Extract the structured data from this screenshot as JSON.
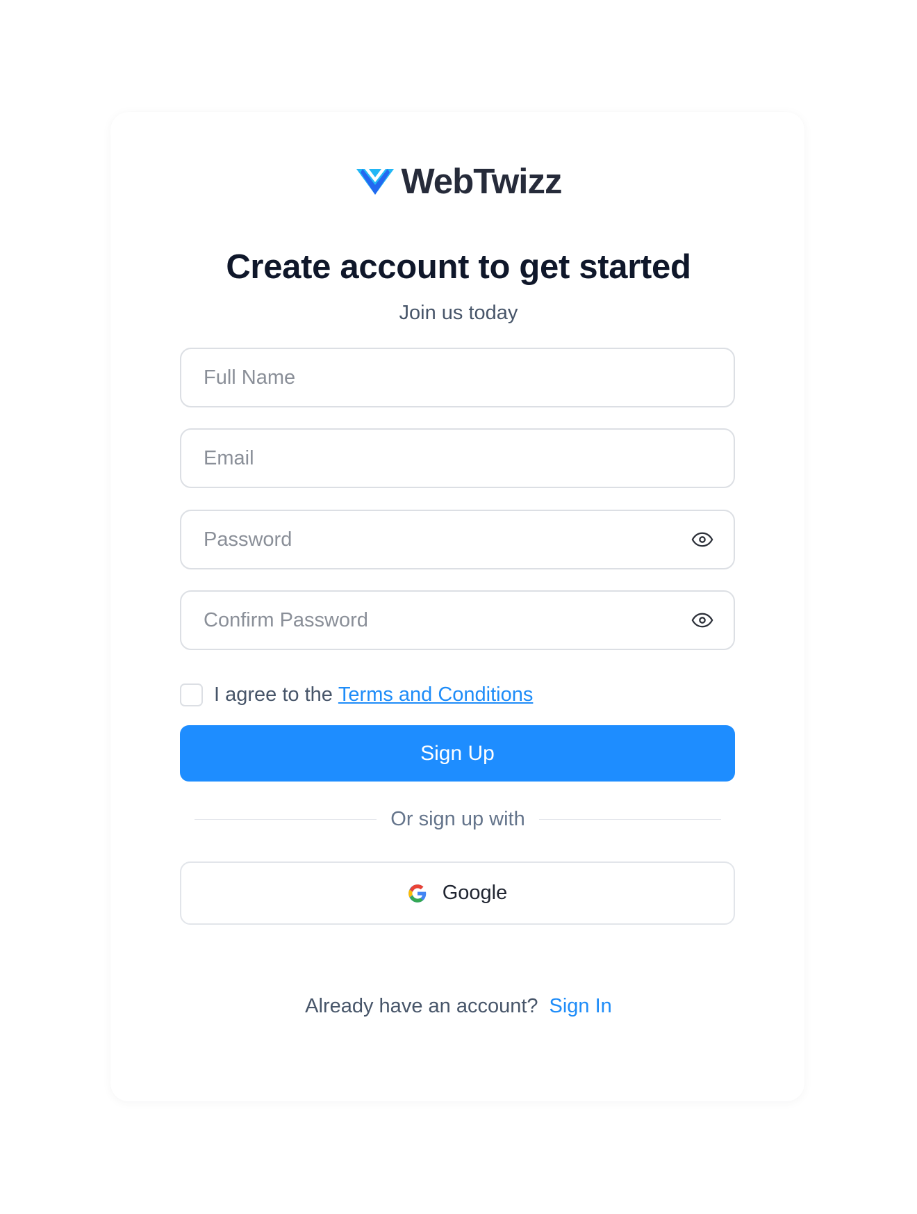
{
  "brand": {
    "name": "WebTwizz",
    "logo_icon": "webtwizz-logo-icon",
    "colors": {
      "primary": "#1e8dff",
      "logo_light": "#22b7f5",
      "logo_dark": "#2368f0"
    }
  },
  "header": {
    "title": "Create account to get started",
    "subtitle": "Join us today"
  },
  "form": {
    "full_name": {
      "placeholder": "Full Name",
      "value": ""
    },
    "email": {
      "placeholder": "Email",
      "value": ""
    },
    "password": {
      "placeholder": "Password",
      "value": "",
      "toggle_icon": "eye-icon"
    },
    "confirm_password": {
      "placeholder": "Confirm Password",
      "value": "",
      "toggle_icon": "eye-icon"
    },
    "agree": {
      "checked": false,
      "text": "I agree to the",
      "link_text": "Terms and Conditions"
    },
    "submit_label": "Sign Up"
  },
  "social": {
    "divider_text": "Or sign up with",
    "google": {
      "label": "Google",
      "icon": "google-icon"
    }
  },
  "footer": {
    "question": "Already have an account?",
    "signin_label": "Sign In"
  }
}
